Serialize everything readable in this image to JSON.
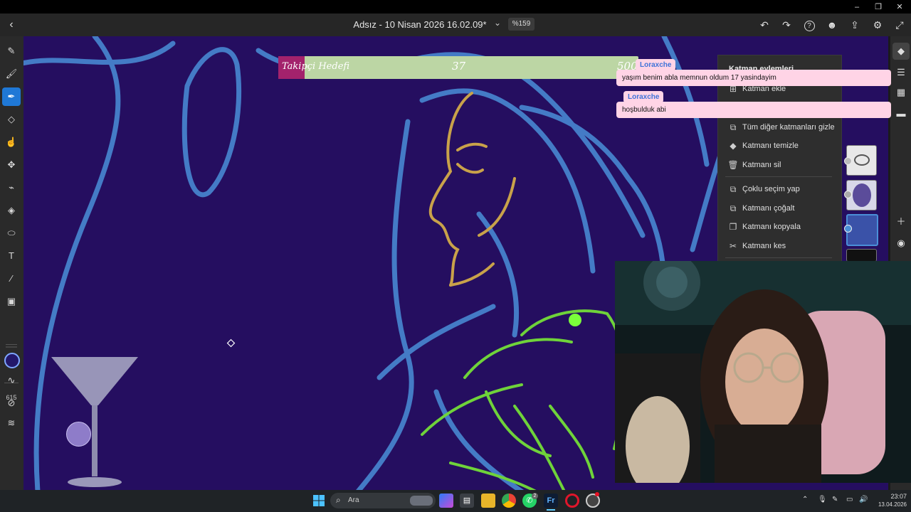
{
  "window": {
    "minimize": "–",
    "maximize": "❐",
    "close": "✕"
  },
  "appbar": {
    "back_icon": "‹",
    "document_title": "Adsız - 10 Nisan 2026 16.02.09*",
    "title_chevron": "⌄",
    "zoom": "%159",
    "icons": [
      "undo-icon",
      "redo-icon",
      "help-icon",
      "user-icon",
      "share-icon",
      "settings-icon",
      "fullscreen-icon"
    ],
    "icon_glyphs": {
      "undo": "↶",
      "redo": "↷",
      "help": "?",
      "user": "☻",
      "share": "⇪",
      "settings": "⚙",
      "fullscreen": "⤢"
    }
  },
  "toolbar": {
    "tools": [
      {
        "name": "pixel-brush-icon",
        "glyph": "✎"
      },
      {
        "name": "live-brush-icon",
        "glyph": "🖌"
      },
      {
        "name": "vector-brush-icon",
        "glyph": "✒",
        "active": true
      },
      {
        "name": "eraser-icon",
        "glyph": "◇"
      },
      {
        "name": "smudge-icon",
        "glyph": "☝"
      },
      {
        "name": "move-icon",
        "glyph": "✥"
      },
      {
        "name": "lasso-icon",
        "glyph": "⌁"
      },
      {
        "name": "fill-icon",
        "glyph": "◈"
      },
      {
        "name": "shape-icon",
        "glyph": "⬭"
      },
      {
        "name": "text-icon",
        "glyph": "T"
      },
      {
        "name": "eyedropper-icon",
        "glyph": "⁄"
      },
      {
        "name": "image-icon",
        "glyph": "▣"
      }
    ],
    "color_hex": "#23186a",
    "brush_size": "615"
  },
  "layer_menu": {
    "title": "Katman eylemleri",
    "items": [
      {
        "label": "Katman ekle",
        "icon": "add-layer-icon",
        "glyph": "⊞"
      },
      {
        "label": "Tüm diğer katmanları gizle",
        "icon": "hide-layers-icon",
        "glyph": "⧉"
      },
      {
        "label": "Katmanı temizle",
        "icon": "clear-layer-icon",
        "glyph": "◆"
      },
      {
        "label": "Katmanı sil",
        "icon": "trash-icon",
        "glyph": "🗑"
      },
      {
        "label": "Çoklu seçim yap",
        "icon": "multi-select-icon",
        "glyph": "⧉"
      },
      {
        "label": "Katmanı çoğalt",
        "icon": "duplicate-icon",
        "glyph": "⧉"
      },
      {
        "label": "Katmanı kopyala",
        "icon": "copy-icon",
        "glyph": "❐"
      },
      {
        "label": "Katmanı kes",
        "icon": "scissors-icon",
        "glyph": "✂"
      }
    ]
  },
  "overlay": {
    "goal": {
      "title": "Takipçi Hedefi",
      "current": "37",
      "target": "500",
      "progress": 0.074
    },
    "chat": [
      {
        "user": "Loraxche",
        "message": "yaşım benim abla memnun oldum 17 yasindayim"
      },
      {
        "user": "Loraxche",
        "message": "hoşbulduk abi"
      }
    ]
  },
  "taskbar": {
    "search_placeholder": "Ara",
    "time": "23:07",
    "date": "13.04.2026",
    "whatsapp_badge": "2",
    "apps": [
      "start-icon",
      "search-icon",
      "widgets-icon",
      "store-icon",
      "explorer-icon",
      "chrome-icon",
      "whatsapp-icon",
      "fresco-icon",
      "opera-icon",
      "obs-icon"
    ]
  },
  "colors": {
    "canvas": "#250e60",
    "accent": "#1f78d6",
    "chat_bg": "#ffd4e6",
    "goal_bar": "#bcd6a4",
    "goal_fill": "#a3226c"
  }
}
